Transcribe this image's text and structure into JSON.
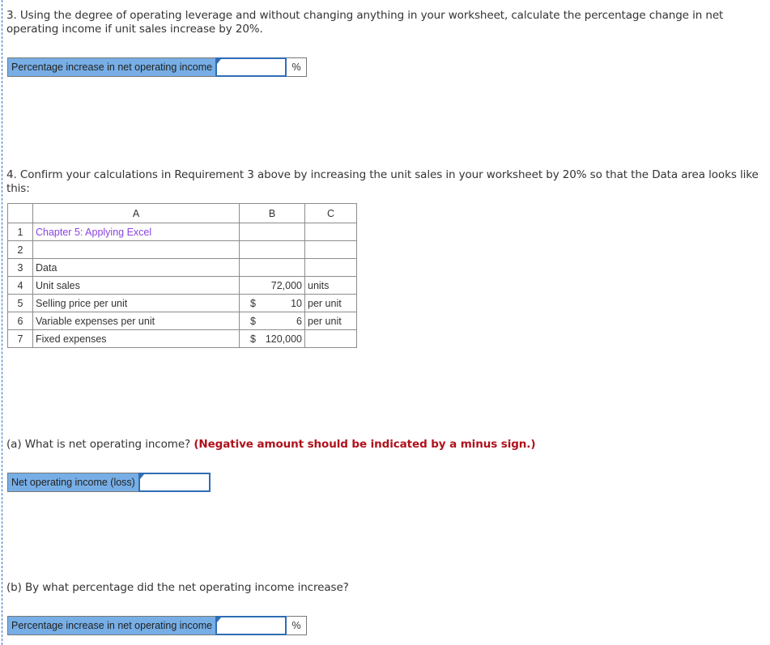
{
  "requirement3": {
    "text": "3. Using the degree of operating leverage and without changing anything in your worksheet, calculate the percentage change in net operating income if unit sales increase by 20%.",
    "answer": {
      "label": "Percentage increase in net operating income",
      "value": "",
      "unit": "%"
    }
  },
  "requirement4": {
    "text": "4. Confirm your calculations in Requirement 3 above by increasing the unit sales in your worksheet by 20% so that the Data area looks like this:"
  },
  "worksheet": {
    "columns": [
      "A",
      "B",
      "C"
    ],
    "rows": [
      {
        "num": "1",
        "a": "Chapter 5: Applying Excel",
        "b_cur": "",
        "b_val": "",
        "c": ""
      },
      {
        "num": "2",
        "a": "",
        "b_cur": "",
        "b_val": "",
        "c": ""
      },
      {
        "num": "3",
        "a": "Data",
        "b_cur": "",
        "b_val": "",
        "c": ""
      },
      {
        "num": "4",
        "a": "Unit sales",
        "b_cur": "",
        "b_val": "72,000",
        "c": "units"
      },
      {
        "num": "5",
        "a": "Selling price per unit",
        "b_cur": "$",
        "b_val": "10",
        "c": "per unit"
      },
      {
        "num": "6",
        "a": "Variable expenses per unit",
        "b_cur": "$",
        "b_val": "6",
        "c": "per unit"
      },
      {
        "num": "7",
        "a": "Fixed expenses",
        "b_cur": "$",
        "b_val": "120,000",
        "c": ""
      }
    ]
  },
  "partA": {
    "question": "(a) What is net operating income?",
    "warning": "(Negative amount should be indicated by a minus sign.)",
    "answer": {
      "label": "Net operating income (loss)",
      "value": ""
    }
  },
  "partB": {
    "question": "(b) By what percentage did the net operating income increase?",
    "answer": {
      "label": "Percentage increase in net operating income",
      "value": "",
      "unit": "%"
    }
  }
}
